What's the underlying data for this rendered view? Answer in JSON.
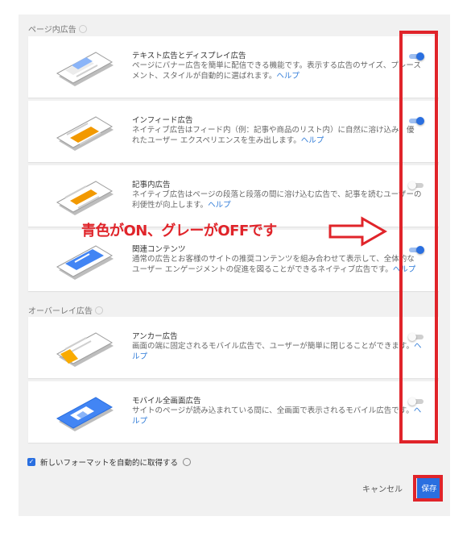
{
  "sections": {
    "page": "ページ内広告",
    "overlay": "オーバーレイ広告"
  },
  "cards": [
    {
      "title": "テキスト広告とディスプレイ広告",
      "desc": "ページにバナー広告を簡単に配信できる機能です。表示する広告のサイズ、プレースメント、スタイルが自動的に選ばれます。",
      "help": "ヘルプ",
      "enabled": true,
      "color": "#8ab4f8"
    },
    {
      "title": "インフィード広告",
      "desc": "ネイティブ広告はフィード内（例：記事や商品のリスト内）に自然に溶け込み、優れたユーザー エクスペリエンスを生み出します。",
      "help": "ヘルプ",
      "enabled": true,
      "color": "#f29900"
    },
    {
      "title": "記事内広告",
      "desc": "ネイティブ広告はページの段落と段落の間に溶け込む広告で、記事を読むユーザーの利便性が向上します。",
      "help": "ヘルプ",
      "enabled": false,
      "color": "#f29900"
    },
    {
      "title": "関連コンテンツ",
      "desc": "通常の広告とお客様のサイトの推奨コンテンツを組み合わせて表示して、全体的なユーザー エンゲージメントの促進を図ることができるネイティブ広告です。",
      "help": "ヘルプ",
      "enabled": true,
      "color": "#4285f4"
    },
    {
      "title": "アンカー広告",
      "desc": "画面の端に固定されるモバイル広告で、ユーザーが簡単に閉じることができます。",
      "help": "ヘルプ",
      "enabled": false,
      "color": "#f9ab00"
    },
    {
      "title": "モバイル全画面広告",
      "desc": "サイトのページが読み込まれている間に、全画面で表示されるモバイル広告です。",
      "help": "ヘルプ",
      "enabled": false,
      "color": "#4285f4"
    }
  ],
  "auto_format_label": "新しいフォーマットを自動的に取得する",
  "buttons": {
    "cancel": "キャンセル",
    "save": "保存"
  },
  "annotation": "青色がON、グレーがOFFです",
  "colors": {
    "accent": "#2a6fe0",
    "annotation_red": "#e0242a"
  }
}
